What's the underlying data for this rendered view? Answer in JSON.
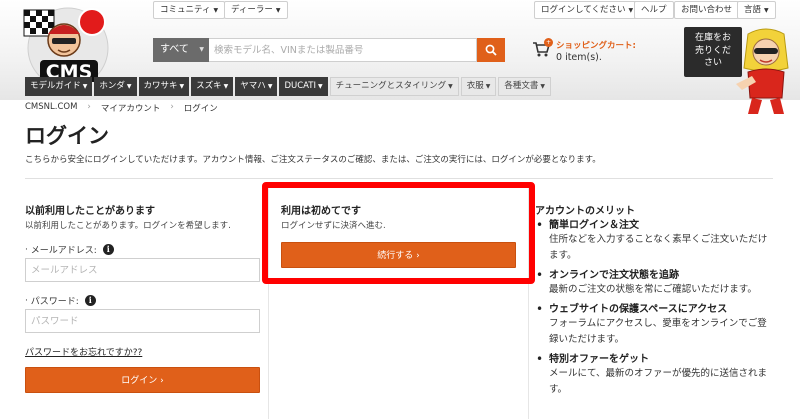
{
  "header": {
    "logo_text": "CMS",
    "top_menu": {
      "community": "コミュニティ",
      "dealer": "ディーラー",
      "login": "ログインしてください",
      "help": "ヘルプ",
      "contact": "お問い合わせ",
      "language": "言語"
    },
    "search": {
      "category": "すべて",
      "placeholder": "検索モデル名、VINまたは製品番号"
    },
    "cart": {
      "label": "ショッピングカート:",
      "count": "0 item(s)."
    },
    "stock_box": {
      "line1": "在庫をお",
      "line2": "売りくだ",
      "line3": "さい"
    }
  },
  "nav": [
    {
      "label": "モデルガイド",
      "style": "dark"
    },
    {
      "label": "ホンダ",
      "style": "dark"
    },
    {
      "label": "カワサキ",
      "style": "dark"
    },
    {
      "label": "スズキ",
      "style": "dark"
    },
    {
      "label": "ヤマハ",
      "style": "dark"
    },
    {
      "label": "DUCATI",
      "style": "dark"
    },
    {
      "label": "チューニングとスタイリング",
      "style": "light"
    },
    {
      "label": "衣服",
      "style": "light"
    },
    {
      "label": "各種文書",
      "style": "light"
    }
  ],
  "breadcrumb": [
    "CMSNL.COM",
    "マイアカウント",
    "ログイン"
  ],
  "page": {
    "title": "ログイン",
    "intro": "こちらから安全にログインしていただけます。アカウント情報、ご注文ステータスのご確認、または、ご注文の実行には、ログインが必要となります。"
  },
  "login_section": {
    "title": "以前利用したことがあります",
    "subtitle": "以前利用したことがあります。ログインを希望します.",
    "email_label": "メールアドレス:",
    "email_placeholder": "メールアドレス",
    "password_label": "パスワード:",
    "password_placeholder": "パスワード",
    "forgot": "パスワードをお忘れですか??",
    "button": "ログイン"
  },
  "guest_section": {
    "title": "利用は初めてです",
    "subtitle": "ログインせずに決済へ進む.",
    "button": "続行する"
  },
  "benefits": {
    "title": "アカウントのメリット",
    "items": [
      {
        "title": "簡単ログイン＆注文",
        "desc": "住所などを入力することなく素早くご注文いただけます。"
      },
      {
        "title": "オンラインで注文状態を追跡",
        "desc": "最新のご注文の状態を常にご確認いただけます。"
      },
      {
        "title": "ウェブサイトの保護スペースにアクセス",
        "desc": "フォーラムにアクセスし、愛車をオンラインでご登録いただけます。"
      },
      {
        "title": "特別オファーをゲット",
        "desc": "メールにて、最新のオファーが優先的に送信されます。"
      }
    ]
  },
  "colors": {
    "accent": "#e0601a",
    "nav_dark": "#3a3a3a",
    "highlight": "#ff0000"
  }
}
